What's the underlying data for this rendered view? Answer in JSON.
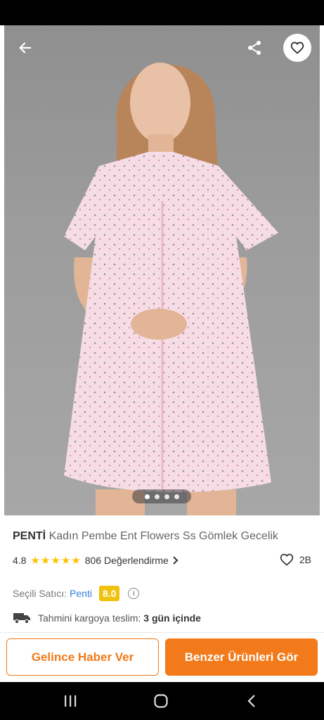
{
  "product": {
    "brand": "PENTİ",
    "name": "Kadın Pembe Ent Flowers Ss Gömlek Gecelik",
    "rating": "4.8",
    "star_count": 5,
    "reviews_label": "806 Değerlendirme",
    "favorites": "2B",
    "image_pages": 4,
    "active_page": 1
  },
  "seller": {
    "label": "Seçili Satıcı:",
    "name": "Penti",
    "score": "8.0"
  },
  "shipping": {
    "label": "Tahmini kargoya teslim:",
    "days": "3 gün içinde"
  },
  "actions": {
    "notify_label": "Gelince Haber Ver",
    "similar_label": "Benzer Ürünleri Gör"
  },
  "icons": {
    "back": "arrow-left-icon",
    "share": "share-icon",
    "favorite": "heart-outline-icon",
    "star": "star-icon",
    "info": "info-icon",
    "truck": "truck-icon",
    "nav_recents": "recents-icon",
    "nav_home": "home-icon",
    "nav_back": "nav-back-icon"
  },
  "colors": {
    "accent": "#f27a1a",
    "star": "#ffc000",
    "seller_link": "#2e7fd8",
    "seller_score_bg": "#f0c20c"
  }
}
